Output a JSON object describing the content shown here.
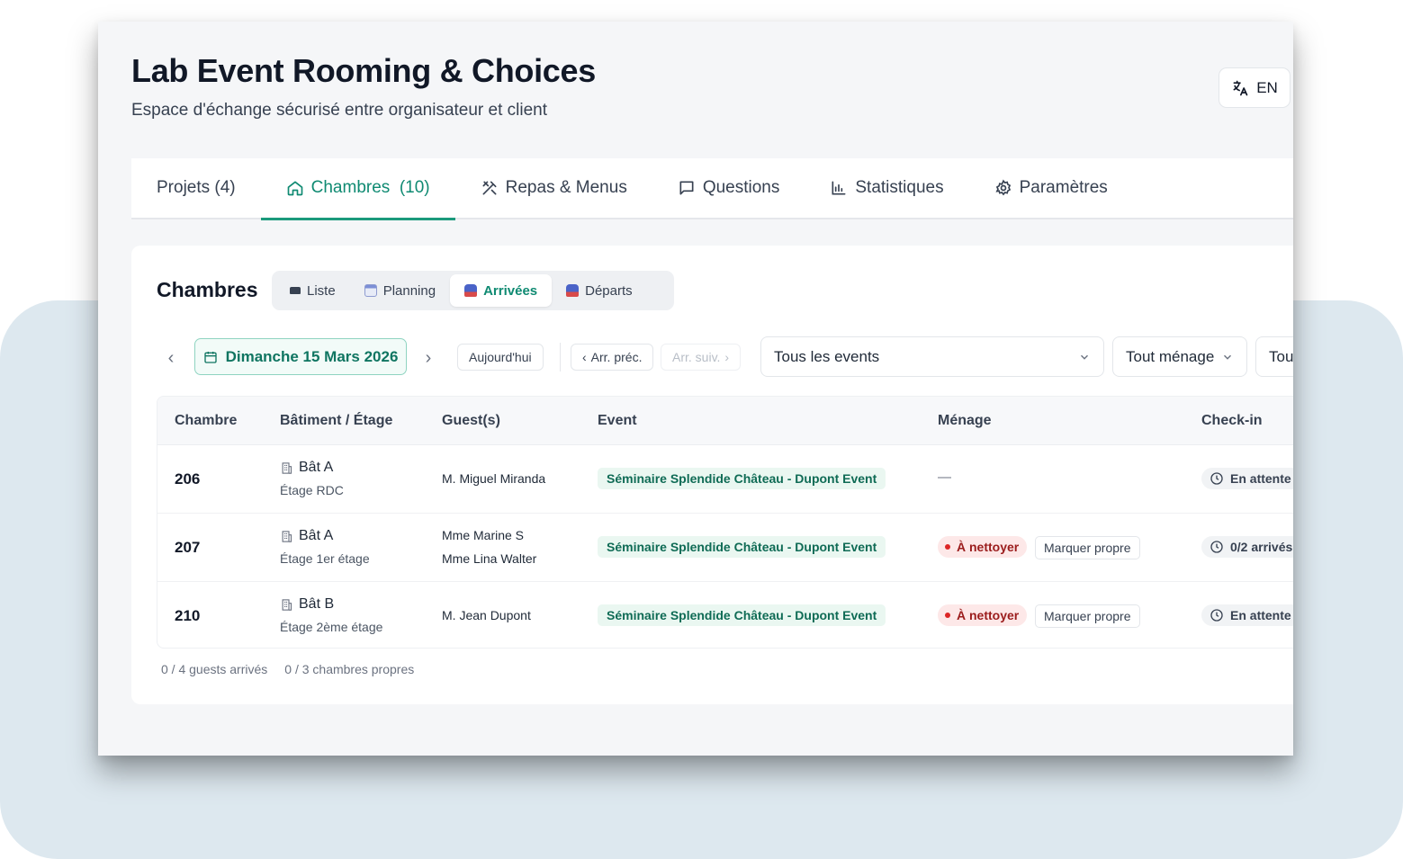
{
  "header": {
    "title": "Lab Event Rooming & Choices",
    "subtitle": "Espace d'échange sécurisé entre organisateur et client",
    "language_button": "EN"
  },
  "tabs": [
    {
      "label": "Projets (4)",
      "icon": "none"
    },
    {
      "label": "Chambres  (10)",
      "icon": "home-icon",
      "active": true
    },
    {
      "label": "Repas & Menus",
      "icon": "utensils-icon"
    },
    {
      "label": "Questions",
      "icon": "message-icon"
    },
    {
      "label": "Statistiques",
      "icon": "bar-chart-icon"
    },
    {
      "label": "Paramètres",
      "icon": "gear-icon"
    }
  ],
  "rooms_view": {
    "title": "Chambres",
    "segments": [
      {
        "label": "Liste",
        "icon": "bed-icon"
      },
      {
        "label": "Planning",
        "icon": "calendar-icon"
      },
      {
        "label": "Arrivées",
        "icon": "arrivals-icon",
        "active": true
      },
      {
        "label": "Départs",
        "icon": "departures-icon"
      }
    ],
    "toolbar": {
      "date": "Dimanche 15 Mars 2026",
      "today": "Aujourd'hui",
      "prev_arrival": "Arr. préc.",
      "next_arrival": "Arr. suiv.",
      "event_filter": "Tous les events",
      "cleaning_filter": "Tout ménage",
      "extra_filter": "Tou"
    },
    "columns": [
      "Chambre",
      "Bâtiment / Étage",
      "Guest(s)",
      "Event",
      "Ménage",
      "Check-in"
    ],
    "rows": [
      {
        "room": "206",
        "building": "Bât A",
        "floor": "Étage RDC",
        "guests": [
          "M. Miguel Miranda"
        ],
        "event": "Séminaire Splendide Château - Dupont Event",
        "cleaning": "—",
        "cleaning_action": "",
        "checkin": "En attente"
      },
      {
        "room": "207",
        "building": "Bât A",
        "floor": "Étage 1er étage",
        "guests": [
          "Mme Marine S",
          "Mme Lina Walter"
        ],
        "event": "Séminaire Splendide Château - Dupont Event",
        "cleaning": "À nettoyer",
        "cleaning_action": "Marquer propre",
        "checkin": "0/2 arrivés"
      },
      {
        "room": "210",
        "building": "Bât B",
        "floor": "Étage 2ème étage",
        "guests": [
          "M. Jean Dupont"
        ],
        "event": "Séminaire Splendide Château - Dupont Event",
        "cleaning": "À nettoyer",
        "cleaning_action": "Marquer propre",
        "checkin": "En attente"
      }
    ],
    "footer": {
      "guests_arrived": "0 / 4 guests arrivés",
      "rooms_clean": "0 / 3 chambres propres"
    }
  },
  "colors": {
    "accent": "#0f8a72",
    "event_chip_bg": "#eaf7f1",
    "dirty_chip_bg": "#fde8e8",
    "background_panel": "#dde8ef"
  }
}
